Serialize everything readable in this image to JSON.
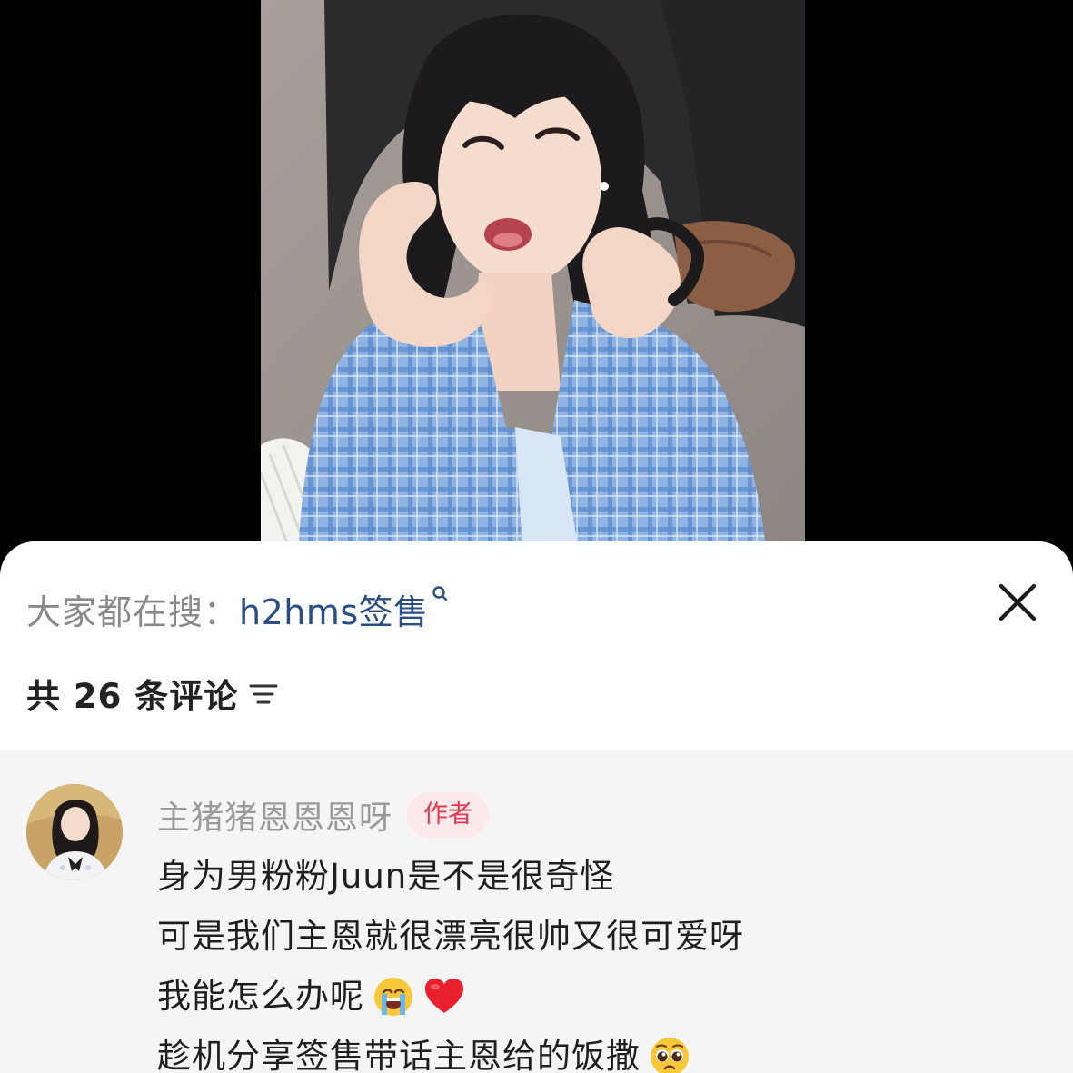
{
  "search_bar": {
    "prefix": "大家都在搜：",
    "term": "h2hms签售",
    "term_icon": "search-icon"
  },
  "close_icon": "close-icon",
  "comments_header": {
    "count_text": "共 26 条评论",
    "sort_icon": "sort-icon"
  },
  "comment": {
    "author": "主猪猪恩恩恩呀",
    "badge": "作者",
    "lines": [
      "身为男粉粉Juun是不是很奇怪",
      "可是我们主恩就很漂亮很帅又很可爱呀",
      "我能怎么办呢",
      "趁机分享签售带话主恩给的饭撒"
    ],
    "line_emojis": [
      [],
      [],
      [
        "loudly-crying-face",
        "red-heart"
      ],
      [
        "pleading-face"
      ]
    ]
  },
  "colors": {
    "search_term": "#2a4f84",
    "badge_text": "#e8384f",
    "badge_bg": "#fde8ea",
    "comment_bg": "#f5f5f5"
  }
}
